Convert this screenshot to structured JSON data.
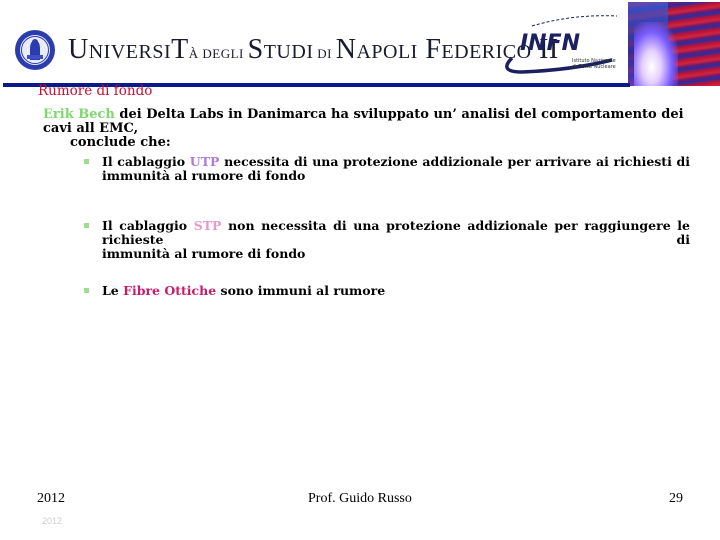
{
  "header": {
    "university": {
      "name_parts": [
        "U",
        "NIVERS",
        "I",
        "T",
        "À",
        " DEGLI ",
        "S",
        "TUDI",
        " DI ",
        "N",
        "APOLI",
        " F",
        "EDERICO",
        " II"
      ],
      "full_name": "Università degli Studi di Napoli Federico II",
      "seal_icon": "university-seal-icon"
    },
    "infn": {
      "acronym": "INFN",
      "subtitle_line1": "Istituto Nazionale",
      "subtitle_line2": "di Fisica Nucleare"
    },
    "accent_color": "#0a1a8c"
  },
  "slide": {
    "title": "Rumore di fondo",
    "title_color": "#c8102e",
    "intro": {
      "highlight": "Erik Bech",
      "text_line1": " dei Delta Labs in Danimarca ha sviluppato un’ analisi del comportamento dei cavi all EMC,",
      "text_line2": "conclude che:"
    },
    "bullets": [
      {
        "pre": "Il cablaggio ",
        "highlight": "UTP",
        "post_line1": " necessita di una protezione addizionale per arrivare ai richiesti di",
        "line2": "immunità al rumore di fondo"
      },
      {
        "pre": "Il cablaggio ",
        "highlight": "STP",
        "post_line1": " non necessita di una protezione addizionale per raggiungere le richieste di",
        "line2": "immunità al rumore di fondo"
      },
      {
        "pre": "Le ",
        "highlight": "Fibre Ottiche",
        "post_line1": " sono immuni al rumore",
        "line2": ""
      }
    ],
    "colors": {
      "erik_bech": "#7ed86e",
      "utp": "#b07ad6",
      "stp": "#e79ad0",
      "fibre_ottiche": "#c71b6b",
      "bullet_marker": "#9fdc8d"
    }
  },
  "footer": {
    "year": "2012",
    "year_faint": "2012",
    "author": "Prof. Guido Russo",
    "page_number": "29"
  }
}
